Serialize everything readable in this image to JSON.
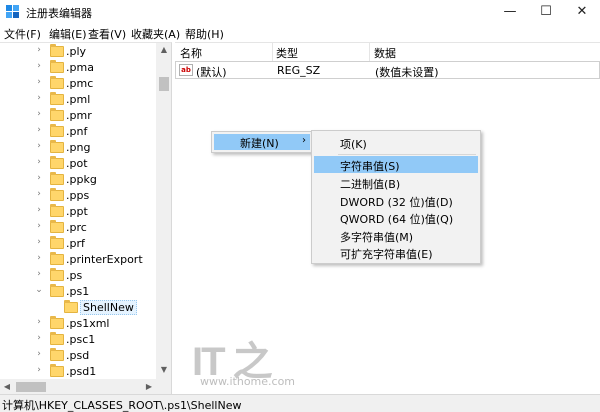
{
  "window": {
    "title": "注册表编辑器",
    "min_glyph": "—",
    "max_glyph": "☐",
    "close_glyph": "✕"
  },
  "menu": [
    "文件(F)",
    "编辑(E)",
    "查看(V)",
    "收藏夹(A)",
    "帮助(H)"
  ],
  "tree": {
    "items": [
      {
        "label": ".ply",
        "expandable": true
      },
      {
        "label": ".pma",
        "expandable": true
      },
      {
        "label": ".pmc",
        "expandable": true
      },
      {
        "label": ".pml",
        "expandable": true
      },
      {
        "label": ".pmr",
        "expandable": true
      },
      {
        "label": ".pnf",
        "expandable": true
      },
      {
        "label": ".png",
        "expandable": true
      },
      {
        "label": ".pot",
        "expandable": true
      },
      {
        "label": ".ppkg",
        "expandable": true
      },
      {
        "label": ".pps",
        "expandable": true
      },
      {
        "label": ".ppt",
        "expandable": true
      },
      {
        "label": ".prc",
        "expandable": true
      },
      {
        "label": ".prf",
        "expandable": true
      },
      {
        "label": ".printerExport",
        "expandable": true
      },
      {
        "label": ".ps",
        "expandable": true
      },
      {
        "label": ".ps1",
        "expandable": true,
        "expanded": true
      },
      {
        "label": "ShellNew",
        "expandable": false,
        "child": true,
        "selected": true
      },
      {
        "label": ".ps1xml",
        "expandable": true
      },
      {
        "label": ".psc1",
        "expandable": true
      },
      {
        "label": ".psd",
        "expandable": true
      },
      {
        "label": ".psd1",
        "expandable": true
      }
    ]
  },
  "columns": {
    "name": "名称",
    "type": "类型",
    "data": "数据"
  },
  "values": [
    {
      "name": "(默认)",
      "type": "REG_SZ",
      "data": "(数值未设置)",
      "icon": "ab"
    }
  ],
  "context_menu": {
    "new_label": "新建(N)",
    "arrow": "›",
    "submenu": [
      {
        "label": "项(K)"
      },
      {
        "label": "字符串值(S)",
        "highlighted": true
      },
      {
        "label": "二进制值(B)"
      },
      {
        "label": "DWORD (32 位)值(D)"
      },
      {
        "label": "QWORD (64 位)值(Q)"
      },
      {
        "label": "多字符串值(M)"
      },
      {
        "label": "可扩充字符串值(E)"
      }
    ]
  },
  "watermark": {
    "logo": "IT之家",
    "url": "www.ithome.com"
  },
  "status": "计算机\\HKEY_CLASSES_ROOT\\.ps1\\ShellNew",
  "colors": {
    "highlight": "#91c9f7",
    "folder": "#ffd66b"
  }
}
